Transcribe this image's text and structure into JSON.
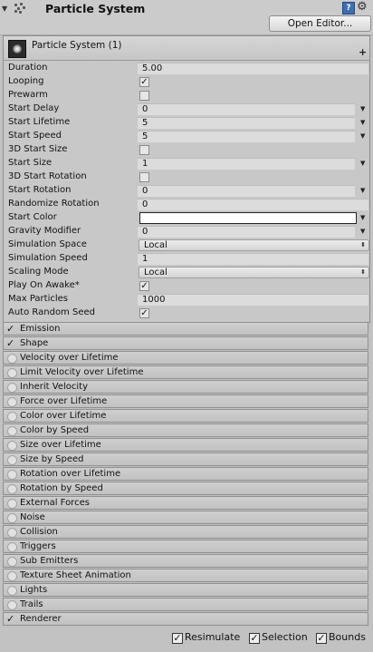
{
  "header": {
    "title": "Particle System",
    "open_editor_label": "Open Editor..."
  },
  "main_module": {
    "title": "Particle System (1)",
    "properties": [
      {
        "label": "Duration",
        "kind": "field",
        "value": "5.00"
      },
      {
        "label": "Looping",
        "kind": "checkbox",
        "checked": true
      },
      {
        "label": "Prewarm",
        "kind": "checkbox",
        "checked": false
      },
      {
        "label": "Start Delay",
        "kind": "field-dd",
        "value": "0"
      },
      {
        "label": "Start Lifetime",
        "kind": "field-dd",
        "value": "5"
      },
      {
        "label": "Start Speed",
        "kind": "field-dd",
        "value": "5"
      },
      {
        "label": "3D Start Size",
        "kind": "checkbox",
        "checked": false
      },
      {
        "label": "Start Size",
        "kind": "field-dd",
        "value": "1"
      },
      {
        "label": "3D Start Rotation",
        "kind": "checkbox",
        "checked": false
      },
      {
        "label": "Start Rotation",
        "kind": "field-dd",
        "value": "0"
      },
      {
        "label": "Randomize Rotation",
        "kind": "field",
        "value": "0"
      },
      {
        "label": "Start Color",
        "kind": "color",
        "value": "#ffffff"
      },
      {
        "label": "Gravity Modifier",
        "kind": "field-dd",
        "value": "0"
      },
      {
        "label": "Simulation Space",
        "kind": "enum",
        "value": "Local"
      },
      {
        "label": "Simulation Speed",
        "kind": "field",
        "value": "1"
      },
      {
        "label": "Scaling Mode",
        "kind": "enum",
        "value": "Local"
      },
      {
        "label": "Play On Awake*",
        "kind": "checkbox",
        "checked": true
      },
      {
        "label": "Max Particles",
        "kind": "field",
        "value": "1000"
      },
      {
        "label": "Auto Random Seed",
        "kind": "checkbox",
        "checked": true
      }
    ]
  },
  "modules": [
    {
      "label": "Emission",
      "enabled": true
    },
    {
      "label": "Shape",
      "enabled": true
    },
    {
      "label": "Velocity over Lifetime",
      "enabled": false
    },
    {
      "label": "Limit Velocity over Lifetime",
      "enabled": false
    },
    {
      "label": "Inherit Velocity",
      "enabled": false
    },
    {
      "label": "Force over Lifetime",
      "enabled": false
    },
    {
      "label": "Color over Lifetime",
      "enabled": false
    },
    {
      "label": "Color by Speed",
      "enabled": false
    },
    {
      "label": "Size over Lifetime",
      "enabled": false
    },
    {
      "label": "Size by Speed",
      "enabled": false
    },
    {
      "label": "Rotation over Lifetime",
      "enabled": false
    },
    {
      "label": "Rotation by Speed",
      "enabled": false
    },
    {
      "label": "External Forces",
      "enabled": false
    },
    {
      "label": "Noise",
      "enabled": false
    },
    {
      "label": "Collision",
      "enabled": false
    },
    {
      "label": "Triggers",
      "enabled": false
    },
    {
      "label": "Sub Emitters",
      "enabled": false
    },
    {
      "label": "Texture Sheet Animation",
      "enabled": false
    },
    {
      "label": "Lights",
      "enabled": false
    },
    {
      "label": "Trails",
      "enabled": false
    },
    {
      "label": "Renderer",
      "enabled": true
    }
  ],
  "footer": {
    "resimulate": {
      "label": "Resimulate",
      "checked": true
    },
    "selection": {
      "label": "Selection",
      "checked": true
    },
    "bounds": {
      "label": "Bounds",
      "checked": true
    }
  },
  "icons": {
    "fold": "triangle-down",
    "component": "particle-system-icon",
    "help": "help-icon",
    "settings": "gear-icon"
  }
}
